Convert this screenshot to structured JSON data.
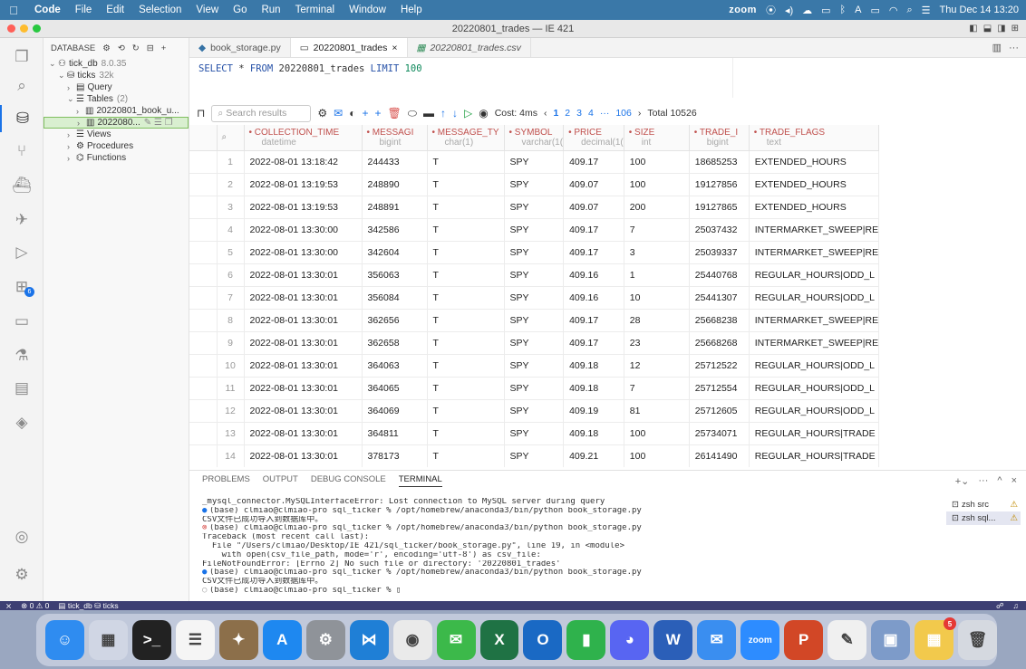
{
  "menubar": {
    "app": "Code",
    "items": [
      "File",
      "Edit",
      "Selection",
      "View",
      "Go",
      "Run",
      "Terminal",
      "Window",
      "Help"
    ],
    "zoom": "zoom",
    "datetime": "Thu Dec 14  13:20"
  },
  "window": {
    "title": "20220801_trades — IE 421"
  },
  "sidebar": {
    "header": "DATABASE",
    "tree": [
      {
        "chev": "⌄",
        "indent": 0,
        "icon": "",
        "label": "tick_db",
        "meta": "8.0.35"
      },
      {
        "chev": "⌄",
        "indent": 1,
        "icon": "",
        "label": "ticks",
        "meta": "32k"
      },
      {
        "chev": "›",
        "indent": 2,
        "icon": "",
        "label": "Query",
        "meta": ""
      },
      {
        "chev": "⌄",
        "indent": 2,
        "icon": "",
        "label": "Tables",
        "meta": "(2)"
      },
      {
        "chev": "›",
        "indent": 3,
        "icon": "",
        "label": "20220801_book_u...",
        "meta": ""
      },
      {
        "chev": "›",
        "indent": 3,
        "icon": "",
        "label": "2022080...",
        "meta": "",
        "sel": true
      },
      {
        "chev": "›",
        "indent": 2,
        "icon": "",
        "label": "Views",
        "meta": ""
      },
      {
        "chev": "›",
        "indent": 2,
        "icon": "",
        "label": "Procedures",
        "meta": ""
      },
      {
        "chev": "›",
        "indent": 2,
        "icon": "",
        "label": "Functions",
        "meta": ""
      }
    ]
  },
  "tabs": [
    {
      "label": "book_storage.py",
      "active": false,
      "italic": false,
      "close": ""
    },
    {
      "label": "20220801_trades",
      "active": true,
      "italic": false,
      "close": "×"
    },
    {
      "label": "20220801_trades.csv",
      "active": false,
      "italic": true,
      "close": ""
    }
  ],
  "query": {
    "text_parts": [
      {
        "t": "SELECT",
        "c": "#2651a7"
      },
      {
        "t": " * ",
        "c": "#333"
      },
      {
        "t": "FROM",
        "c": "#2651a7"
      },
      {
        "t": " 20220801_trades ",
        "c": "#333"
      },
      {
        "t": "LIMIT",
        "c": "#2651a7"
      },
      {
        "t": " 100",
        "c": "#098658"
      }
    ]
  },
  "toolbar": {
    "search_placeholder": "Search results",
    "cost": "Cost: 4ms",
    "pages": [
      "1",
      "2",
      "3",
      "4",
      "···",
      "106"
    ],
    "total": "Total 10526"
  },
  "grid": {
    "columns": [
      {
        "name": "COLLECTION_TIME",
        "type": "datetime",
        "w": 130
      },
      {
        "name": "MESSAGI",
        "type": "bigint",
        "w": 72
      },
      {
        "name": "MESSAGE_TY",
        "type": "char(1)",
        "w": 85
      },
      {
        "name": "SYMBOL",
        "type": "varchar(1(",
        "w": 65
      },
      {
        "name": "PRICE",
        "type": "decimal(1(",
        "w": 62
      },
      {
        "name": "SIZE",
        "type": "int",
        "w": 72
      },
      {
        "name": "TRADE_I",
        "type": "bigint",
        "w": 66
      },
      {
        "name": "TRADE_FLAGS",
        "type": "text",
        "w": 132
      }
    ],
    "rows": [
      [
        "1",
        "2022-08-01 13:18:42",
        "244433",
        "T",
        "SPY",
        "409.17",
        "100",
        "18685253",
        "EXTENDED_HOURS"
      ],
      [
        "2",
        "2022-08-01 13:19:53",
        "248890",
        "T",
        "SPY",
        "409.07",
        "100",
        "19127856",
        "EXTENDED_HOURS"
      ],
      [
        "3",
        "2022-08-01 13:19:53",
        "248891",
        "T",
        "SPY",
        "409.07",
        "200",
        "19127865",
        "EXTENDED_HOURS"
      ],
      [
        "4",
        "2022-08-01 13:30:00",
        "342586",
        "T",
        "SPY",
        "409.17",
        "7",
        "25037432",
        "INTERMARKET_SWEEP|RE"
      ],
      [
        "5",
        "2022-08-01 13:30:00",
        "342604",
        "T",
        "SPY",
        "409.17",
        "3",
        "25039337",
        "INTERMARKET_SWEEP|RE"
      ],
      [
        "6",
        "2022-08-01 13:30:01",
        "356063",
        "T",
        "SPY",
        "409.16",
        "1",
        "25440768",
        "REGULAR_HOURS|ODD_L"
      ],
      [
        "7",
        "2022-08-01 13:30:01",
        "356084",
        "T",
        "SPY",
        "409.16",
        "10",
        "25441307",
        "REGULAR_HOURS|ODD_L"
      ],
      [
        "8",
        "2022-08-01 13:30:01",
        "362656",
        "T",
        "SPY",
        "409.17",
        "28",
        "25668238",
        "INTERMARKET_SWEEP|RE"
      ],
      [
        "9",
        "2022-08-01 13:30:01",
        "362658",
        "T",
        "SPY",
        "409.17",
        "23",
        "25668268",
        "INTERMARKET_SWEEP|RE"
      ],
      [
        "10",
        "2022-08-01 13:30:01",
        "364063",
        "T",
        "SPY",
        "409.18",
        "12",
        "25712522",
        "REGULAR_HOURS|ODD_L"
      ],
      [
        "11",
        "2022-08-01 13:30:01",
        "364065",
        "T",
        "SPY",
        "409.18",
        "7",
        "25712554",
        "REGULAR_HOURS|ODD_L"
      ],
      [
        "12",
        "2022-08-01 13:30:01",
        "364069",
        "T",
        "SPY",
        "409.19",
        "81",
        "25712605",
        "REGULAR_HOURS|ODD_L"
      ],
      [
        "13",
        "2022-08-01 13:30:01",
        "364811",
        "T",
        "SPY",
        "409.18",
        "100",
        "25734071",
        "REGULAR_HOURS|TRADE"
      ],
      [
        "14",
        "2022-08-01 13:30:01",
        "378173",
        "T",
        "SPY",
        "409.21",
        "100",
        "26141490",
        "REGULAR_HOURS|TRADE"
      ]
    ]
  },
  "panel": {
    "tabs": [
      "PROBLEMS",
      "OUTPUT",
      "DEBUG CONSOLE",
      "TERMINAL"
    ],
    "active_tab": "TERMINAL",
    "terminal": [
      {
        "dot": "",
        "text": "_mysql_connector.MySQLInterfaceError: Lost connection to MySQL server during query"
      },
      {
        "dot": "blue",
        "text": "(base) clmiao@clmiao-pro sql_ticker % /opt/homebrew/anaconda3/bin/python book_storage.py"
      },
      {
        "dot": "",
        "text": "CSV文件已成功导入到数据库中。"
      },
      {
        "dot": "red",
        "text": "(base) clmiao@clmiao-pro sql_ticker % /opt/homebrew/anaconda3/bin/python book_storage.py"
      },
      {
        "dot": "",
        "text": "Traceback (most recent call last):"
      },
      {
        "dot": "",
        "text": "  File \"/Users/clmiao/Desktop/IE 421/sql_ticker/book_storage.py\", line 19, in <module>"
      },
      {
        "dot": "",
        "text": "    with open(csv_file_path, mode='r', encoding='utf-8') as csv_file:"
      },
      {
        "dot": "",
        "text": "FileNotFoundError: [Errno 2] No such file or directory: '20220801_trades'"
      },
      {
        "dot": "blue",
        "text": "(base) clmiao@clmiao-pro sql_ticker % /opt/homebrew/anaconda3/bin/python book_storage.py"
      },
      {
        "dot": "",
        "text": "CSV文件已成功导入到数据库中。"
      },
      {
        "dot": "hollow",
        "text": "(base) clmiao@clmiao-pro sql_ticker % ▯"
      }
    ],
    "shells": [
      {
        "label": "zsh src",
        "active": false
      },
      {
        "label": "zsh sql...",
        "active": true
      }
    ]
  },
  "status": {
    "problems": "⊗ 0 ⚠ 0",
    "db": "tick_db",
    "table": "ticks"
  },
  "dock": [
    {
      "name": "finder",
      "bg": "#2f8cf0",
      "glyph": "☺"
    },
    {
      "name": "launchpad",
      "bg": "#d0d6e4",
      "glyph": "▦"
    },
    {
      "name": "terminal",
      "bg": "#222222",
      "glyph": ">_"
    },
    {
      "name": "reminders",
      "bg": "#f5f5f5",
      "glyph": "☰"
    },
    {
      "name": "notes-game",
      "bg": "#8c6f4a",
      "glyph": "✦"
    },
    {
      "name": "app-store",
      "bg": "#1e88f0",
      "glyph": "A"
    },
    {
      "name": "system-settings",
      "bg": "#8f9399",
      "glyph": "⚙"
    },
    {
      "name": "vscode",
      "bg": "#1f7fd6",
      "glyph": "⋈"
    },
    {
      "name": "chrome",
      "bg": "#eaeaea",
      "glyph": "◉"
    },
    {
      "name": "wechat",
      "bg": "#3cb94a",
      "glyph": "✉"
    },
    {
      "name": "excel",
      "bg": "#1f7244",
      "glyph": "X"
    },
    {
      "name": "outlook",
      "bg": "#1a69c4",
      "glyph": "O"
    },
    {
      "name": "numbers",
      "bg": "#2fb24c",
      "glyph": "▮"
    },
    {
      "name": "discord",
      "bg": "#5865f2",
      "glyph": "◕"
    },
    {
      "name": "word",
      "bg": "#2b5fb8",
      "glyph": "W"
    },
    {
      "name": "mail",
      "bg": "#3a8ef0",
      "glyph": "✉"
    },
    {
      "name": "zoom",
      "bg": "#2d8cff",
      "glyph": "zoom"
    },
    {
      "name": "powerpoint",
      "bg": "#d24726",
      "glyph": "P"
    },
    {
      "name": "textedit",
      "bg": "#f0f0f0",
      "glyph": "✎"
    },
    {
      "name": "preview",
      "bg": "#7d9bc9",
      "glyph": "▣"
    },
    {
      "name": "microsoft-store",
      "bg": "#f2c94c",
      "glyph": "▦",
      "badge": "5"
    },
    {
      "name": "trash",
      "bg": "#d5d9e0",
      "glyph": "🗑"
    }
  ],
  "colors": {
    "accent": "#1a73e8",
    "statusbar": "#3d3f73",
    "menubar": "#3a78a8",
    "column_header": "#c0504d"
  }
}
